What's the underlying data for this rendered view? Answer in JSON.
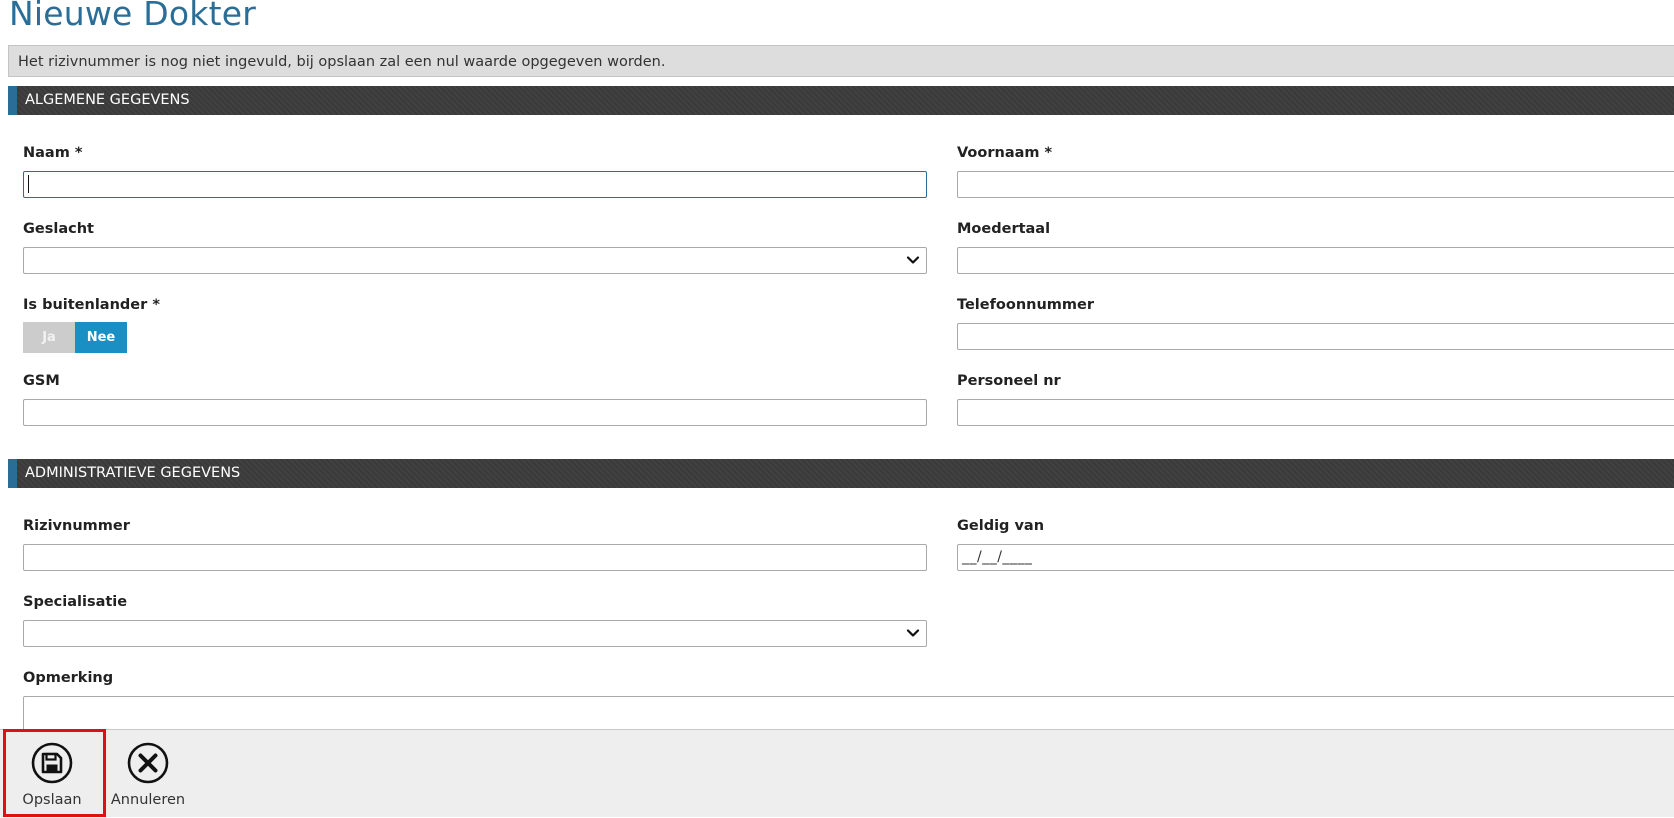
{
  "page": {
    "title": "Nieuwe Dokter"
  },
  "notice": {
    "text": "Het rizivnummer is nog niet ingevuld, bij opslaan zal een nul waarde opgegeven worden."
  },
  "sections": {
    "general": {
      "title": "ALGEMENE GEGEVENS"
    },
    "admin": {
      "title": "ADMINISTRATIEVE GEGEVENS"
    }
  },
  "fields": {
    "naam": {
      "label": "Naam *",
      "value": ""
    },
    "voornaam": {
      "label": "Voornaam *",
      "value": ""
    },
    "geslacht": {
      "label": "Geslacht",
      "selected": ""
    },
    "moedertaal": {
      "label": "Moedertaal",
      "value": ""
    },
    "buitenlander": {
      "label": "Is buitenlander *",
      "option_yes": "Ja",
      "option_no": "Nee",
      "selected": "Nee"
    },
    "telefoon": {
      "label": "Telefoonnummer",
      "value": ""
    },
    "gsm": {
      "label": "GSM",
      "value": ""
    },
    "personeel": {
      "label": "Personeel nr",
      "value": ""
    },
    "riziv": {
      "label": "Rizivnummer",
      "value": ""
    },
    "geldig_van": {
      "label": "Geldig van",
      "mask": "__/__/____"
    },
    "specialisatie": {
      "label": "Specialisatie",
      "selected": ""
    },
    "opmerking": {
      "label": "Opmerking",
      "value": ""
    }
  },
  "toolbar": {
    "save": {
      "label": "Opslaan",
      "icon": "floppy-disk-icon"
    },
    "cancel": {
      "label": "Annuleren",
      "icon": "close-circle-icon"
    }
  },
  "colors": {
    "title": "#2a6e98",
    "section_accent": "#2a6e98",
    "section_bg": "#3a3a3a",
    "toggle_active": "#1a8fc4",
    "highlight": "#e01010"
  }
}
